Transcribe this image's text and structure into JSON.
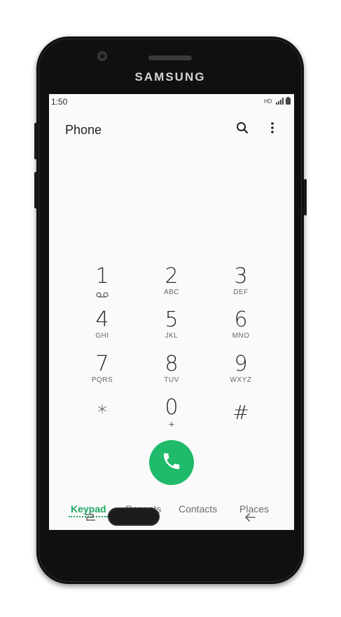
{
  "device": {
    "brand": "SAMSUNG"
  },
  "status_bar": {
    "time": "1:50",
    "icons": [
      "hd-voice-icon",
      "signal-icon",
      "battery-icon"
    ]
  },
  "app_bar": {
    "title": "Phone",
    "actions": [
      "search-icon",
      "more-options-icon"
    ]
  },
  "keypad": {
    "keys": [
      {
        "digit": "1",
        "sub": "voicemail-icon"
      },
      {
        "digit": "2",
        "sub": "ABC"
      },
      {
        "digit": "3",
        "sub": "DEF"
      },
      {
        "digit": "4",
        "sub": "GHI"
      },
      {
        "digit": "5",
        "sub": "JKL"
      },
      {
        "digit": "6",
        "sub": "MNO"
      },
      {
        "digit": "7",
        "sub": "PQRS"
      },
      {
        "digit": "8",
        "sub": "TUV"
      },
      {
        "digit": "9",
        "sub": "WXYZ"
      },
      {
        "digit": "*",
        "sub": ""
      },
      {
        "digit": "0",
        "sub": "+"
      },
      {
        "digit": "#",
        "sub": ""
      }
    ]
  },
  "call_button": {
    "icon": "phone-call-icon",
    "color": "#1fba6a"
  },
  "tabs": [
    {
      "label": "Keypad",
      "active": true
    },
    {
      "label": "Recents",
      "active": false
    },
    {
      "label": "Contacts",
      "active": false
    },
    {
      "label": "Places",
      "active": false
    }
  ],
  "colors": {
    "accent": "#1fa862",
    "screen_bg": "#fafafa",
    "device_body": "#101010"
  }
}
